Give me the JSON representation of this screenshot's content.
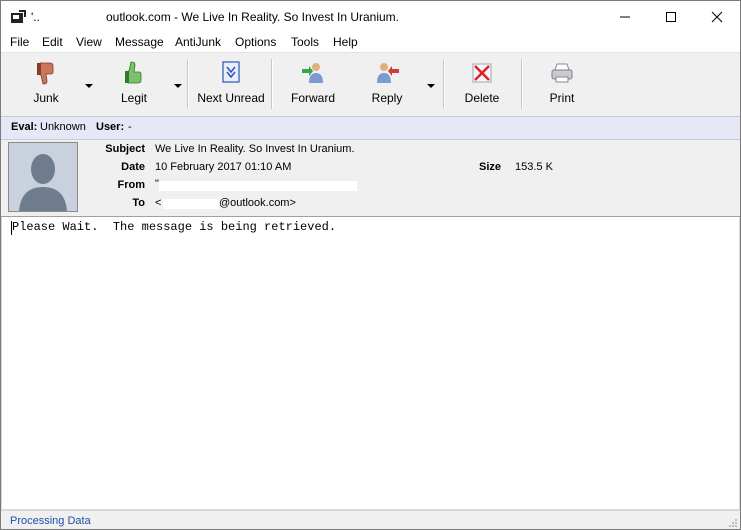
{
  "window": {
    "title_prefix": "'..",
    "title": "outlook.com - We Live In Reality. So Invest In Uranium."
  },
  "menu": [
    "File",
    "Edit",
    "View",
    "Message",
    "AntiJunk",
    "Options",
    "Tools",
    "Help"
  ],
  "toolbar": {
    "junk": "Junk",
    "legit": "Legit",
    "next_unread": "Next Unread",
    "forward": "Forward",
    "reply": "Reply",
    "delete": "Delete",
    "print": "Print"
  },
  "eval_bar": {
    "eval_label": "Eval:",
    "eval_value": "Unknown",
    "user_label": "User:",
    "user_value": "-"
  },
  "message_header": {
    "subject_label": "Subject",
    "subject": "We Live In Reality. So Invest In Uranium.",
    "date_label": "Date",
    "date": "10 February 2017 01:10 AM",
    "size_label": "Size",
    "size": "153.5 K",
    "from_label": "From",
    "from": "\"",
    "to_label": "To",
    "to_prefix": "<",
    "to_suffix": "@outlook.com>"
  },
  "body": {
    "text": "Please Wait.  The message is being retrieved."
  },
  "status": {
    "text": "Processing Data"
  }
}
